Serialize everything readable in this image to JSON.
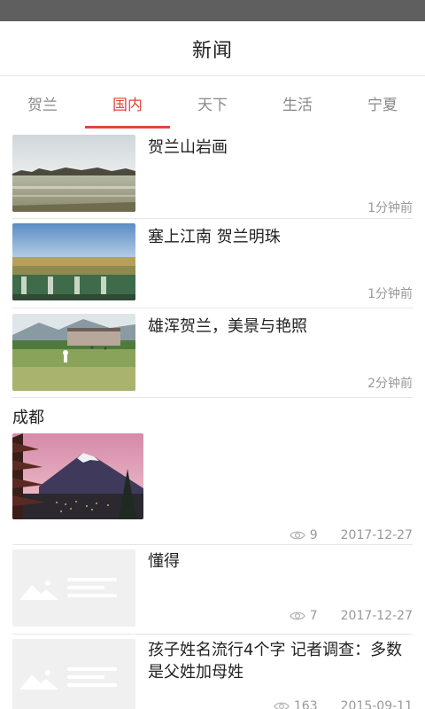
{
  "header": {
    "title": "新闻"
  },
  "tabs": [
    {
      "label": "贺兰",
      "active": false
    },
    {
      "label": "国内",
      "active": true
    },
    {
      "label": "天下",
      "active": false
    },
    {
      "label": "生活",
      "active": false
    },
    {
      "label": "宁夏",
      "active": false
    }
  ],
  "feed": {
    "items": [
      {
        "title": "贺兰山岩画",
        "time": "1分钟前",
        "thumb": "lake-landscape-photo"
      },
      {
        "title": "塞上江南 贺兰明珠",
        "time": "1分钟前",
        "thumb": "field-from-train-photo"
      },
      {
        "title": "雄浑贺兰，美景与艳照",
        "time": "2分钟前",
        "thumb": "playground-mountain-photo"
      }
    ],
    "feature": {
      "title": "成都",
      "views": "9",
      "date": "2017-12-27",
      "thumb": "pagoda-fuji-photo"
    },
    "items2": [
      {
        "title": "懂得",
        "views": "7",
        "date": "2017-12-27",
        "thumb": "image-placeholder-icon"
      },
      {
        "title": "孩子姓名流行4个字 记者调查：多数是父姓加母姓",
        "views": "163",
        "date": "2015-09-11",
        "thumb": "image-placeholder-icon"
      }
    ]
  },
  "colors": {
    "accent": "#e0463b",
    "status_bar": "#5f5f5f",
    "muted": "#999999"
  }
}
